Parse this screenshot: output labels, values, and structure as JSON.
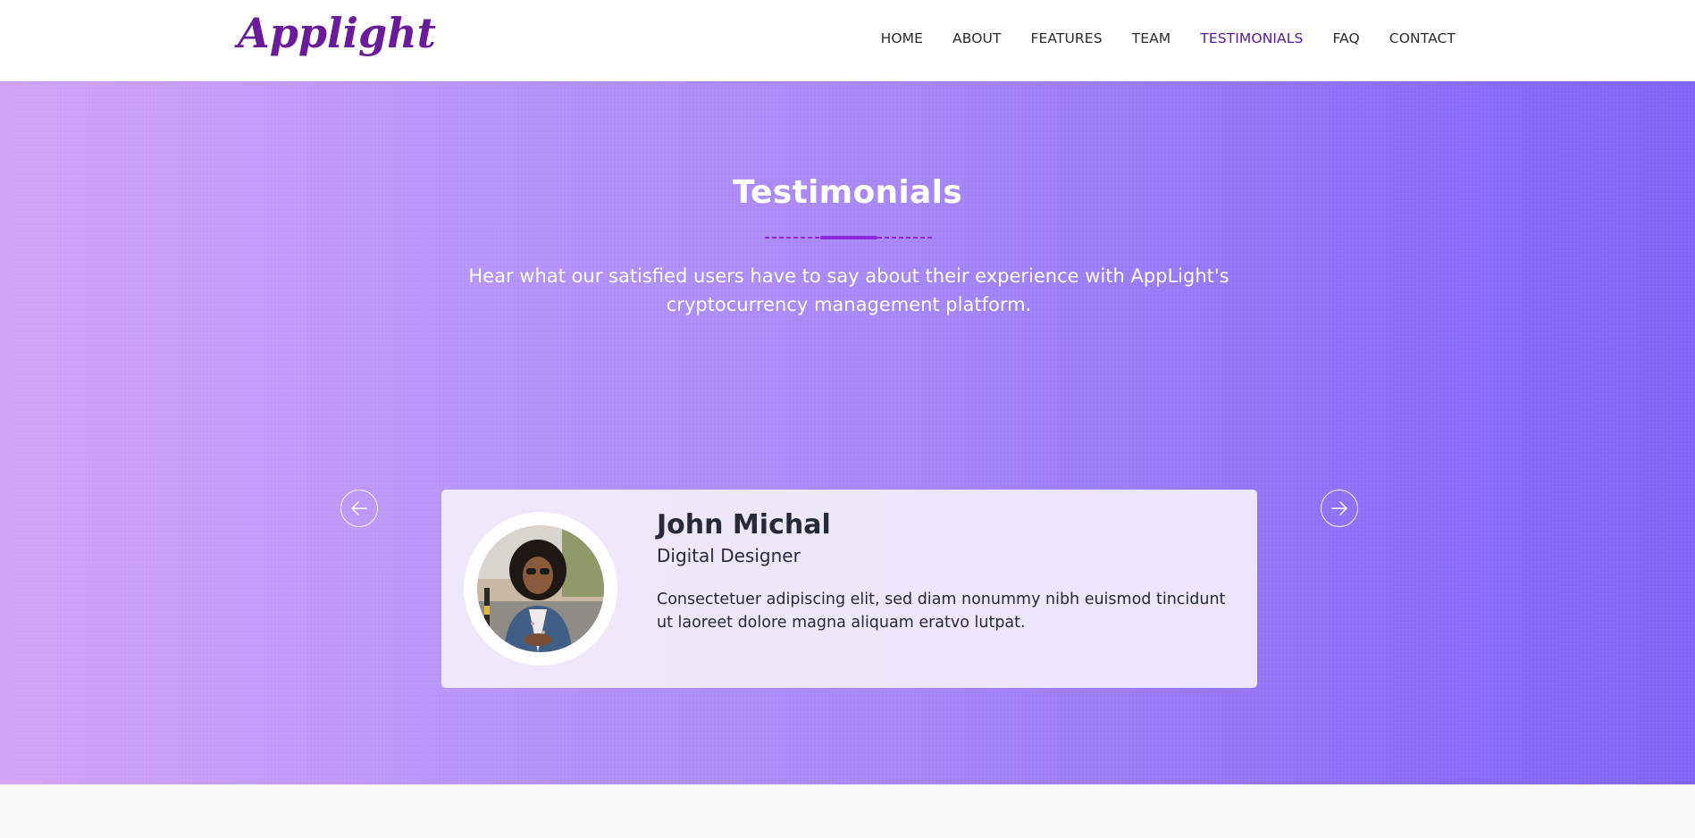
{
  "header": {
    "logo_text": "Applight",
    "brand_color": "#6a1b9a",
    "nav": [
      {
        "label": "HOME",
        "active": false
      },
      {
        "label": "ABOUT",
        "active": false
      },
      {
        "label": "FEATURES",
        "active": false
      },
      {
        "label": "TEAM",
        "active": false
      },
      {
        "label": "TESTIMONIALS",
        "active": true
      },
      {
        "label": "FAQ",
        "active": false
      },
      {
        "label": "CONTACT",
        "active": false
      }
    ]
  },
  "testimonials": {
    "title": "Testimonials",
    "subtitle": "Hear what our satisfied users have to say about their experience with AppLight's cryptocurrency management platform.",
    "accent_color": "#8a25d9",
    "prev_icon": "arrow-left-circle-icon",
    "next_icon": "arrow-right-circle-icon",
    "active_item": {
      "name": "John Michal",
      "role": "Digital Designer",
      "quote": "Consectetuer adipiscing elit, sed diam nonummy nibh euismod tincidunt ut laoreet dolore magna aliquam eratvo lutpat."
    }
  }
}
